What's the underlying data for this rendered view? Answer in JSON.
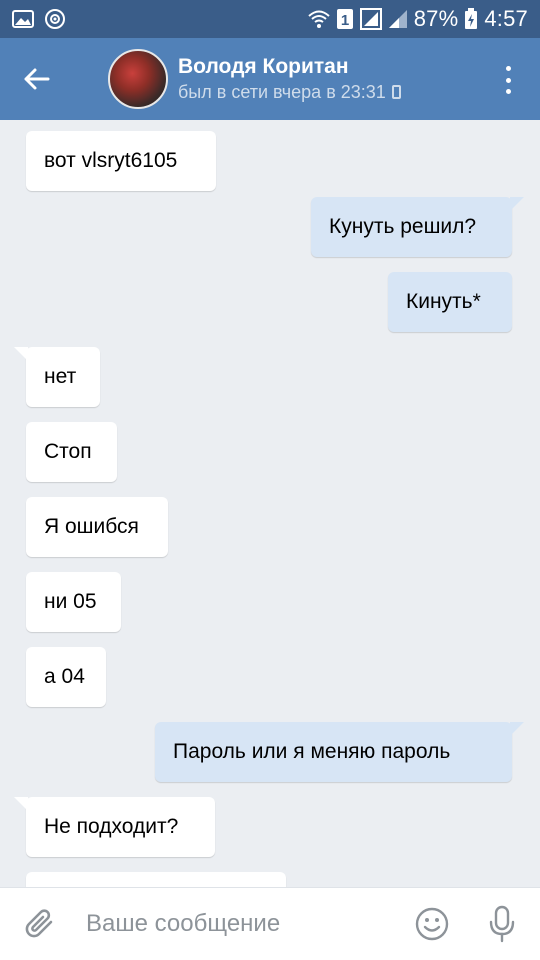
{
  "status_bar": {
    "battery_percent": "87%",
    "time": "4:57",
    "sim_number": "1",
    "icons": [
      "image-icon",
      "camera-rotate-icon",
      "wifi-icon",
      "sim-icon",
      "signal-icon",
      "signal-icon",
      "battery-charging-icon"
    ]
  },
  "header": {
    "contact_name": "Володя Коритан",
    "last_seen": "был в сети вчера в 23:31",
    "icons": [
      "back-arrow-icon",
      "avatar",
      "mobile-phone-icon",
      "more-vert-icon"
    ]
  },
  "messages": [
    {
      "direction": "in",
      "text": "вот vlsryt6105",
      "tail": false
    },
    {
      "direction": "out",
      "text": "Кунуть решил?",
      "tail": true
    },
    {
      "direction": "out",
      "text": "Кинуть*",
      "tail": false
    },
    {
      "direction": "in",
      "text": "нет",
      "tail": true
    },
    {
      "direction": "in",
      "text": "Стоп",
      "tail": false
    },
    {
      "direction": "in",
      "text": "Я ошибся",
      "tail": false
    },
    {
      "direction": "in",
      "text": "ни 05",
      "tail": false
    },
    {
      "direction": "in",
      "text": "а 04",
      "tail": false
    },
    {
      "direction": "out",
      "text": "Пароль или я меняю пароль",
      "tail": true
    },
    {
      "direction": "in",
      "text": "Не подходит?",
      "tail": true
    },
    {
      "direction": "in",
      "text": "",
      "tail": false
    }
  ],
  "composer": {
    "placeholder": "Ваше сообщение",
    "icons": [
      "paperclip-icon",
      "emoji-icon",
      "microphone-icon"
    ]
  },
  "colors": {
    "status_bar": "#3a5d89",
    "toolbar": "#5181b8",
    "chat_background": "#ebeef2",
    "incoming_bubble": "#ffffff",
    "outgoing_bubble": "#d7e5f5"
  }
}
